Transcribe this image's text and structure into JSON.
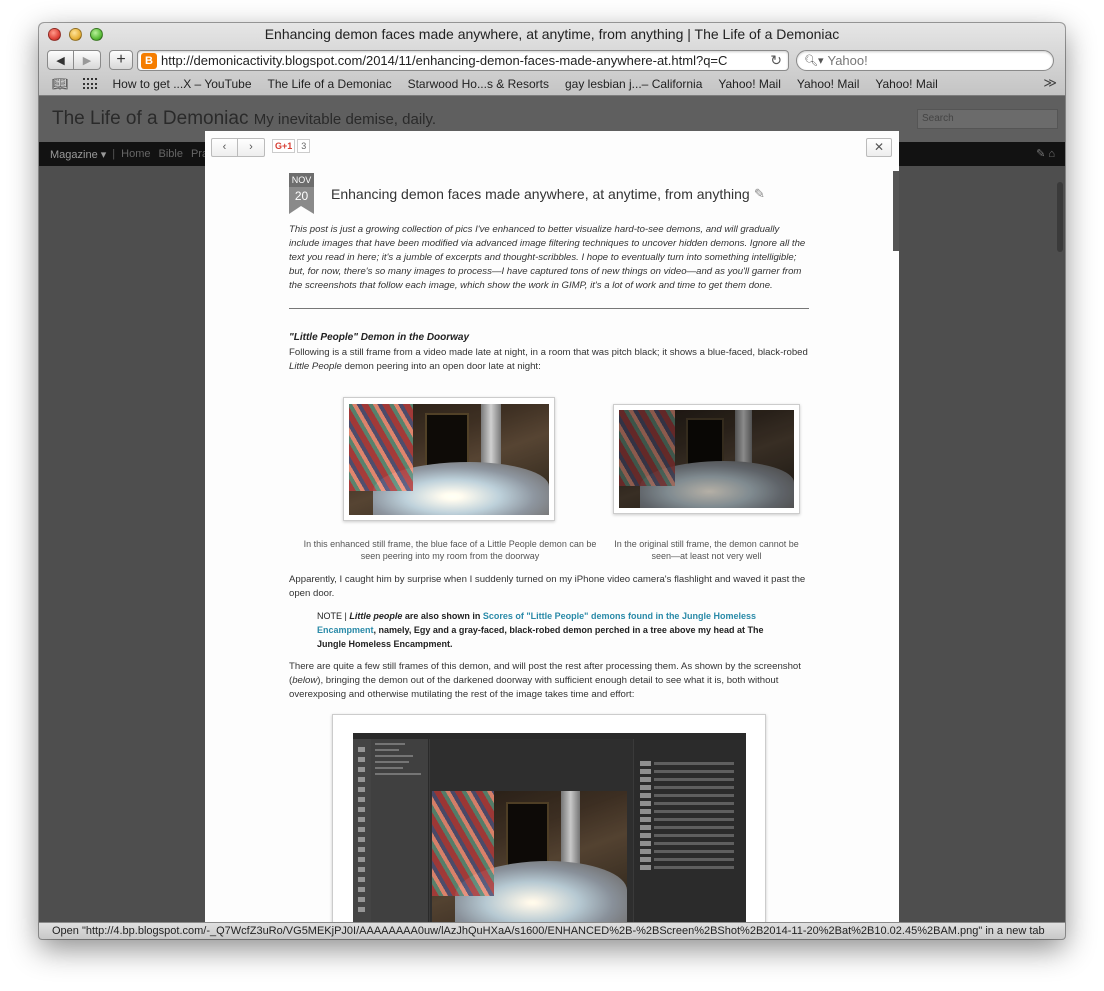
{
  "browser": {
    "window_title": "Enhancing demon faces made anywhere, at anytime, from anything | The Life of a Demoniac",
    "url": "http://demonicactivity.blogspot.com/2014/11/enhancing-demon-faces-made-anywhere-at.html?q=C",
    "search_placeholder": "Yahoo!",
    "bookmarks": [
      "How to get ...X – YouTube",
      "The Life of a Demoniac",
      "Starwood Ho...s & Resorts",
      "gay lesbian j...– California",
      "Yahoo! Mail",
      "Yahoo! Mail",
      "Yahoo! Mail"
    ],
    "status_text": "Open \"http://4.bp.blogspot.com/-_Q7WcfZ3uRo/VG5MEKjPJ0I/AAAAAAAA0uw/lAzJhQuHXaA/s1600/ENHANCED%2B-%2BScreen%2BShot%2B2014-11-20%2Bat%2B10.02.45%2BAM.png\" in a new tab"
  },
  "blog": {
    "title": "The Life of a Demoniac",
    "description": "My inevitable demise, daily.",
    "search_placeholder": "Search",
    "nav_view": "Magazine",
    "nav_links": [
      "Home",
      "Bible",
      "Praye"
    ]
  },
  "lightbox": {
    "gplus_label": "G+1",
    "gplus_count": "3"
  },
  "post": {
    "date_month": "NOV",
    "date_day": "20",
    "title": "Enhancing demon faces made anywhere, at anytime, from anything",
    "intro": "This post is just a growing collection of pics I've enhanced to better visualize hard-to-see demons, and will gradually include images that have been modified via advanced image filtering techniques to uncover hidden demons. Ignore all the text you read in here; it's a jumble of excerpts and thought-scribbles. I hope to eventually turn into something intelligible; but, for now, there's so many images to process—I have captured tons of new things on video—and as you'll garner from the screenshots that follow each image, which show the work in GIMP, it's a lot of work and time to get them done.",
    "section_title": "\"Little People\" Demon in the Doorway",
    "p1_before": "Following is a still frame from a video made late at night, in a room that was pitch black; it shows a blue-faced, black-robed ",
    "p1_em": "Little People",
    "p1_after": " demon peering into an open door late at night:",
    "caption_left": "In this enhanced still frame, the blue face of a Little People demon can be seen peering into my room from the doorway",
    "caption_right": "In the original still frame, the demon cannot be seen—at least not very well",
    "p2": "Apparently, I caught him by surprise when I suddenly turned on my iPhone video camera's flashlight and waved it past the open door.",
    "note_label": "NOTE | ",
    "note_em": "Little people",
    "note_mid": " are also shown in ",
    "note_link": "Scores of \"Little People\" demons found in the Jungle Homeless Encampment",
    "note_after": ", namely, Egy and a gray-faced, black-robed demon perched in a tree above my head at The Jungle Homeless Encampment.",
    "p3_before": "There are quite a few still frames of this demon, and will post the rest after processing them. As shown by the screenshot (",
    "p3_em": "below",
    "p3_after": "), bringing the demon out of the darkened doorway with sufficient enough detail to see what it is, both without overexposing and otherwise mutilating the rest of the image takes time and effort:"
  }
}
